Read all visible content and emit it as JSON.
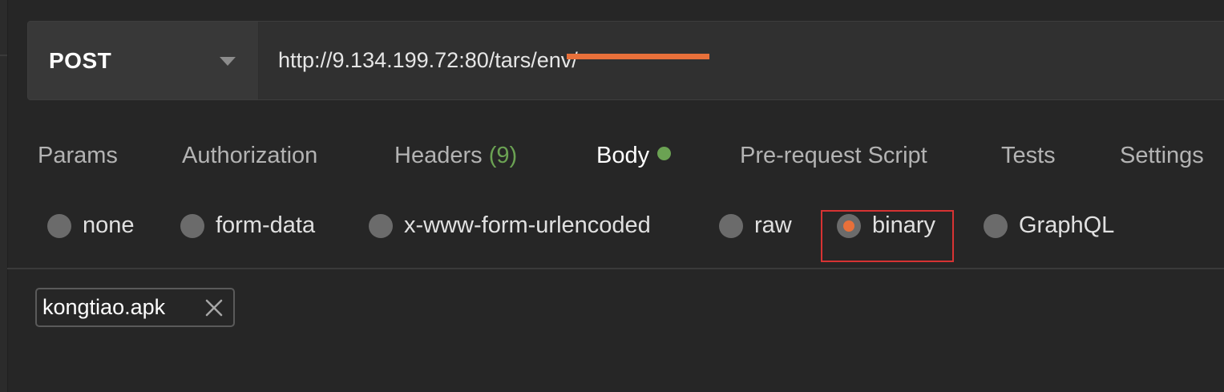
{
  "request": {
    "method": "POST",
    "url": "http://9.134.199.72:80/tars/env/"
  },
  "tabs": [
    {
      "label": "Params"
    },
    {
      "label": "Authorization"
    },
    {
      "label": "Headers",
      "count": "(9)"
    },
    {
      "label": "Body",
      "active": true,
      "indicator": "green-dot"
    },
    {
      "label": "Pre-request Script"
    },
    {
      "label": "Tests"
    },
    {
      "label": "Settings"
    }
  ],
  "body_types": [
    {
      "label": "none",
      "selected": false
    },
    {
      "label": "form-data",
      "selected": false
    },
    {
      "label": "x-www-form-urlencoded",
      "selected": false
    },
    {
      "label": "raw",
      "selected": false
    },
    {
      "label": "binary",
      "selected": true
    },
    {
      "label": "GraphQL",
      "selected": false
    }
  ],
  "file": {
    "name": "kongtiao.apk",
    "remove_icon": "close-icon"
  },
  "colors": {
    "background": "#262626",
    "accent": "#e8703a",
    "success": "#6ba253",
    "highlight": "#d73333"
  }
}
